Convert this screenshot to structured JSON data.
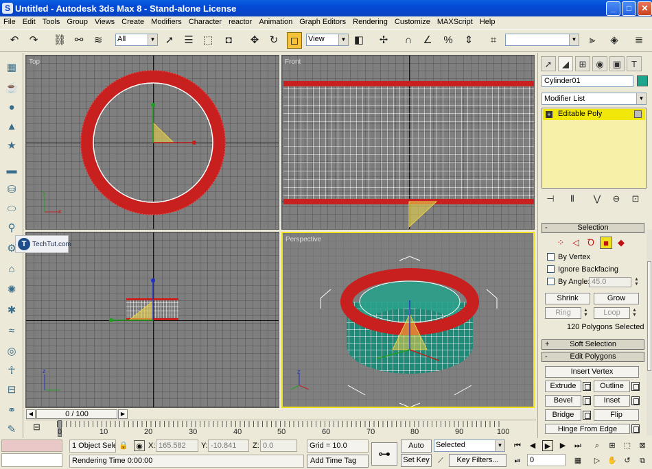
{
  "window": {
    "title": "Untitled - Autodesk 3ds Max 8  - Stand-alone License",
    "min_label": "_",
    "max_label": "□",
    "close_label": "✕"
  },
  "menu": [
    "File",
    "Edit",
    "Tools",
    "Group",
    "Views",
    "Create",
    "Modifiers",
    "Character",
    "reactor",
    "Animation",
    "Graph Editors",
    "Rendering",
    "Customize",
    "MAXScript",
    "Help"
  ],
  "toolbar": {
    "selection_filter": "All",
    "reference_coord": "View",
    "named_selection": ""
  },
  "viewports": {
    "top": {
      "label": "Top",
      "gizmo_x": "x",
      "gizmo_y": "y"
    },
    "front": {
      "label": "Front"
    },
    "left": {
      "label": "",
      "gizmo_z": "z"
    },
    "perspective": {
      "label": "Perspective",
      "gizmo_z": "z"
    }
  },
  "watermark": {
    "mark": "T",
    "text": "TechTut.com"
  },
  "command_panel": {
    "object_name": "Cylinder01",
    "object_color": "#1ea68c",
    "modifier_list": "Modifier List",
    "stack_item": "Editable Poly",
    "stack_item_expand": "+",
    "selection": {
      "title": "Selection",
      "collapse": "-",
      "by_vertex": "By Vertex",
      "ignore_backfacing": "Ignore Backfacing",
      "by_angle": "By Angle:",
      "angle_value": "45.0",
      "shrink": "Shrink",
      "grow": "Grow",
      "ring": "Ring",
      "loop": "Loop",
      "status": "120 Polygons Selected"
    },
    "soft_selection": {
      "title": "Soft Selection",
      "expand": "+"
    },
    "edit_polygons": {
      "title": "Edit Polygons",
      "collapse": "-",
      "insert_vertex": "Insert Vertex",
      "extrude": "Extrude",
      "outline": "Outline",
      "bevel": "Bevel",
      "inset": "Inset",
      "bridge": "Bridge",
      "flip": "Flip",
      "hinge": "Hinge From Edge"
    }
  },
  "timeline": {
    "frame_display": "0 / 100",
    "ticks": [
      "0",
      "10",
      "20",
      "30",
      "40",
      "50",
      "60",
      "70",
      "80",
      "90",
      "100"
    ]
  },
  "status": {
    "selection_info": "1 Object Sele",
    "x_label": "X:",
    "x_value": "165.582",
    "y_label": "Y:",
    "y_value": "-10.841",
    "z_label": "Z:",
    "z_value": "0.0",
    "grid": "Grid = 10.0",
    "rendering_time": "Rendering Time  0:00:00",
    "add_time_tag": "Add Time Tag",
    "auto_key": "Auto Key",
    "set_key": "Set Key",
    "key_mode": "Selected",
    "key_filters": "Key Filters...",
    "current_frame": "0"
  }
}
